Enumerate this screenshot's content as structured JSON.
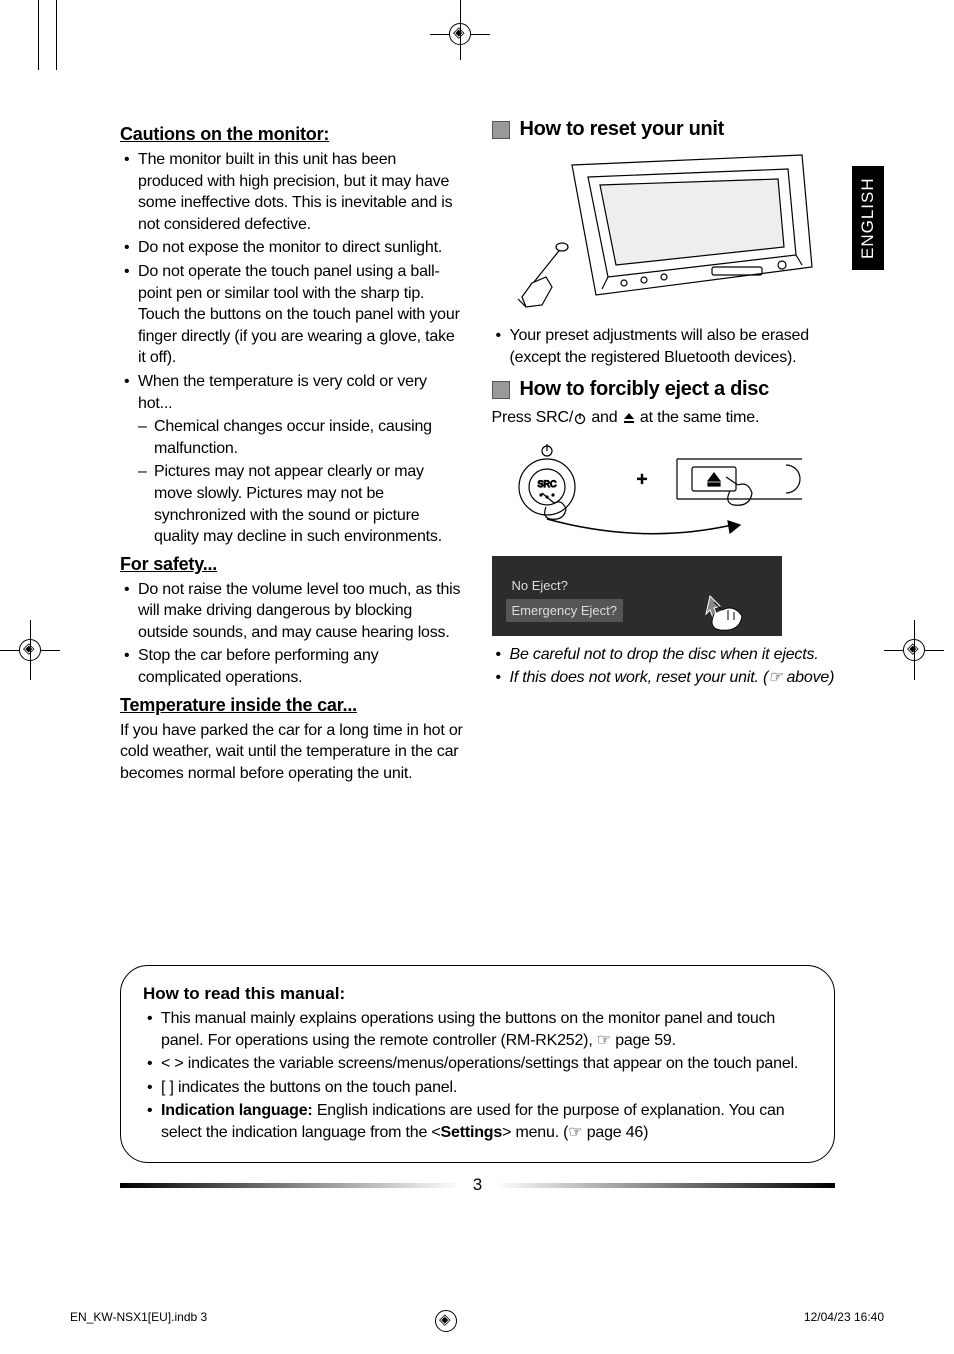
{
  "language_tab": "ENGLISH",
  "left": {
    "h1": "Cautions on the monitor:",
    "b1": [
      "The monitor built in this unit has been produced with high precision, but it may have some ineffective dots. This is inevitable and is not considered defective.",
      "Do not expose the monitor to direct sunlight.",
      "Do not operate the touch panel using a ball-point pen or similar tool with the sharp tip.\nTouch the buttons on the touch panel with your finger directly (if you are wearing a glove, take it off).",
      "When the temperature is very cold or very hot..."
    ],
    "b1_sub": [
      "Chemical changes occur inside, causing malfunction.",
      "Pictures may not appear clearly or may move slowly. Pictures may not be synchronized with the sound or picture quality may decline in such environments."
    ],
    "h2": "For safety...",
    "b2": [
      "Do not raise the volume level too much, as this will make driving dangerous by blocking outside sounds, and may cause hearing loss.",
      "Stop the car before performing any complicated operations."
    ],
    "h3": "Temperature inside the car...",
    "p3": "If you have parked the car for a long time in hot or cold weather, wait until the temperature in the car becomes normal before operating the unit."
  },
  "right": {
    "s1_title": "How to reset your unit",
    "s1_note": "Your preset adjustments will also be erased (except the registered Bluetooth devices).",
    "s2_title": "How to forcibly eject a disc",
    "s2_intro_a": "Press SRC/",
    "s2_intro_b": " and ",
    "s2_intro_c": " at the same time.",
    "eject_label_src": "SRC",
    "eject_plus": "+",
    "screen_opt1": "No Eject?",
    "screen_opt2": "Emergency Eject?",
    "s2_notes": [
      "Be careful not to drop the disc when it ejects.",
      "If this does not work, reset your unit. (☞ above)"
    ]
  },
  "howto": {
    "title": "How to read this manual:",
    "items_a": "This manual mainly explains operations using the buttons on the monitor panel and touch panel. For operations using the remote controller (RM-RK252), ☞ page 59.",
    "items_b": "< > indicates the variable screens/menus/operations/settings that appear on the touch panel.",
    "items_c": "[ ] indicates the buttons on the touch panel.",
    "items_d_prefix": "Indication language:",
    "items_d_rest": " English indications are used for the purpose of explanation. You can select the indication language from the <",
    "items_d_bold": "Settings",
    "items_d_tail": "> menu. (☞ page 46)"
  },
  "page_number": "3",
  "footer_left": "EN_KW-NSX1[EU].indb   3",
  "footer_right": "12/04/23   16:40"
}
